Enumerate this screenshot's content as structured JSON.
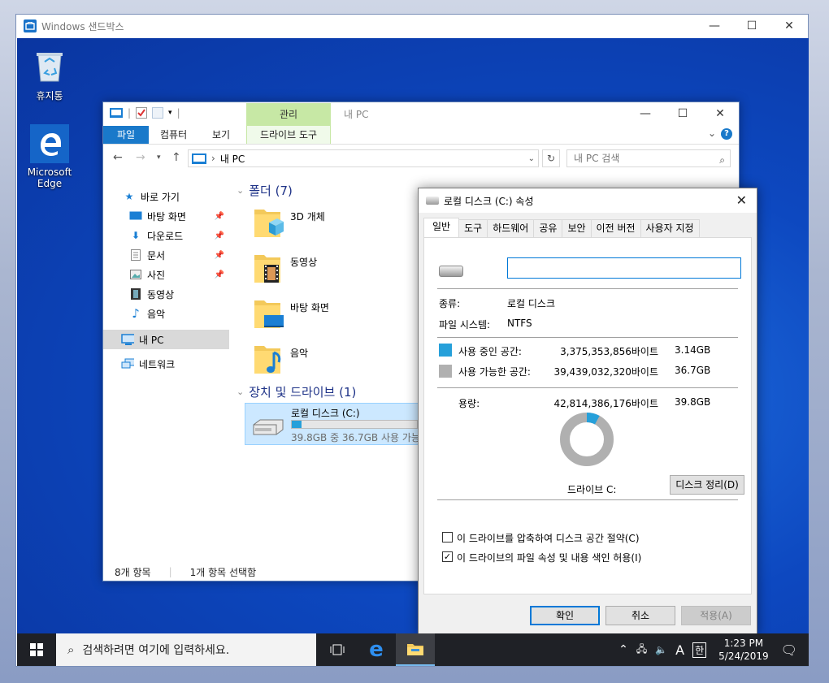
{
  "host": {
    "title": "Windows 샌드박스"
  },
  "desktop": {
    "icons": [
      {
        "label": "휴지통"
      },
      {
        "label": "Microsoft Edge"
      }
    ]
  },
  "explorer": {
    "context_tab_group": "관리",
    "window_title": "내 PC",
    "ribbon_tabs": [
      "파일",
      "컴퓨터",
      "보기",
      "드라이브 도구"
    ],
    "address": "내 PC",
    "search_placeholder": "내 PC 검색",
    "nav": {
      "quick_access": "바로 가기",
      "items": [
        "바탕 화면",
        "다운로드",
        "문서",
        "사진",
        "동영상",
        "음악"
      ],
      "this_pc": "내 PC",
      "network": "네트워크"
    },
    "folders_header": "폴더 (7)",
    "folders": [
      "3D 개체",
      "동영상",
      "바탕 화면",
      "음악"
    ],
    "devices_header": "장치 및 드라이브 (1)",
    "drive": {
      "name": "로컬 디스크 (C:)",
      "free_text": "39.8GB 중 36.7GB 사용 가능",
      "used_fraction": 0.079
    },
    "status": {
      "item_count": "8개 항목",
      "selected": "1개 항목 선택함"
    }
  },
  "props": {
    "title": "로컬 디스크 (C:) 속성",
    "tabs": [
      "일반",
      "도구",
      "하드웨어",
      "공유",
      "보안",
      "이전 버전",
      "사용자 지정"
    ],
    "label_value": "",
    "type_label": "종류:",
    "type_value": "로컬 디스크",
    "fs_label": "파일 시스템:",
    "fs_value": "NTFS",
    "used_label": "사용 중인 공간:",
    "used_bytes": "3,375,353,856바이트",
    "used_size": "3.14GB",
    "free_label": "사용 가능한 공간:",
    "free_bytes": "39,439,032,320바이트",
    "free_size": "36.7GB",
    "capacity_label": "용량:",
    "capacity_bytes": "42,814,386,176바이트",
    "capacity_size": "39.8GB",
    "drive_label": "드라이브 C:",
    "cleanup_button": "디스크 정리(D)",
    "compress_label": "이 드라이브를 압축하여 디스크 공간 절약(C)",
    "compress_checked": false,
    "index_label": "이 드라이브의 파일 속성 및 내용 색인 허용(I)",
    "index_checked": true,
    "ok": "확인",
    "cancel": "취소",
    "apply": "적용(A)",
    "used_color": "#26a0da",
    "free_color": "#b0b0b0",
    "used_fraction": 0.0788
  },
  "taskbar": {
    "search_placeholder": "검색하려면 여기에 입력하세요.",
    "ime_mode": "A",
    "ime_lang": "한",
    "time": "1:23 PM",
    "date": "5/24/2019"
  }
}
